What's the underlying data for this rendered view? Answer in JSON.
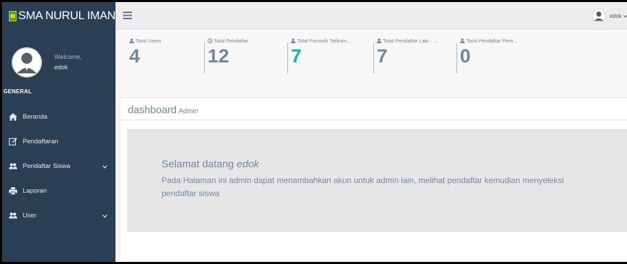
{
  "brand": {
    "name": "SMA NURUL IMAN"
  },
  "profile": {
    "welcome": "Welcome,",
    "username": "edok"
  },
  "sidebar": {
    "section": "GENERAL",
    "items": [
      {
        "label": "Beranda",
        "icon": "home-icon",
        "dropdown": false
      },
      {
        "label": "Pendaftaran",
        "icon": "edit-icon",
        "dropdown": false
      },
      {
        "label": "Pendaftar Siswa",
        "icon": "users-icon",
        "dropdown": true
      },
      {
        "label": "Laporan",
        "icon": "print-icon",
        "dropdown": false
      },
      {
        "label": "User",
        "icon": "users-icon",
        "dropdown": true
      }
    ]
  },
  "topnav": {
    "toggle_icon": "bars-icon",
    "user": "edok"
  },
  "stats": [
    {
      "label": "Total Users",
      "count": "4",
      "icon": "user-icon"
    },
    {
      "label": "Total Pendaftar",
      "count": "12",
      "icon": "clock-icon"
    },
    {
      "label": "Total Formulir Terkum...",
      "count": "7",
      "icon": "user-icon"
    },
    {
      "label": "Total Pendaftar Laki - ...",
      "count": "7",
      "icon": "user-icon"
    },
    {
      "label": "Total Pendaftar Pere...",
      "count": "0",
      "icon": "user-icon"
    }
  ],
  "panel": {
    "title": "dashboard",
    "subtitle": "Admin",
    "greeting_prefix": "Selamat datang",
    "greeting_name": "edok",
    "message": "Pada Halaman ini admin dapat menambahkan akun untuk admin lain, melihat pendaftar kemudian menyeleksi pendaftar siswa"
  },
  "colors": {
    "sidebar": "#2A3F54",
    "accent_green": "#1ABB9C",
    "text": "#73879C"
  }
}
